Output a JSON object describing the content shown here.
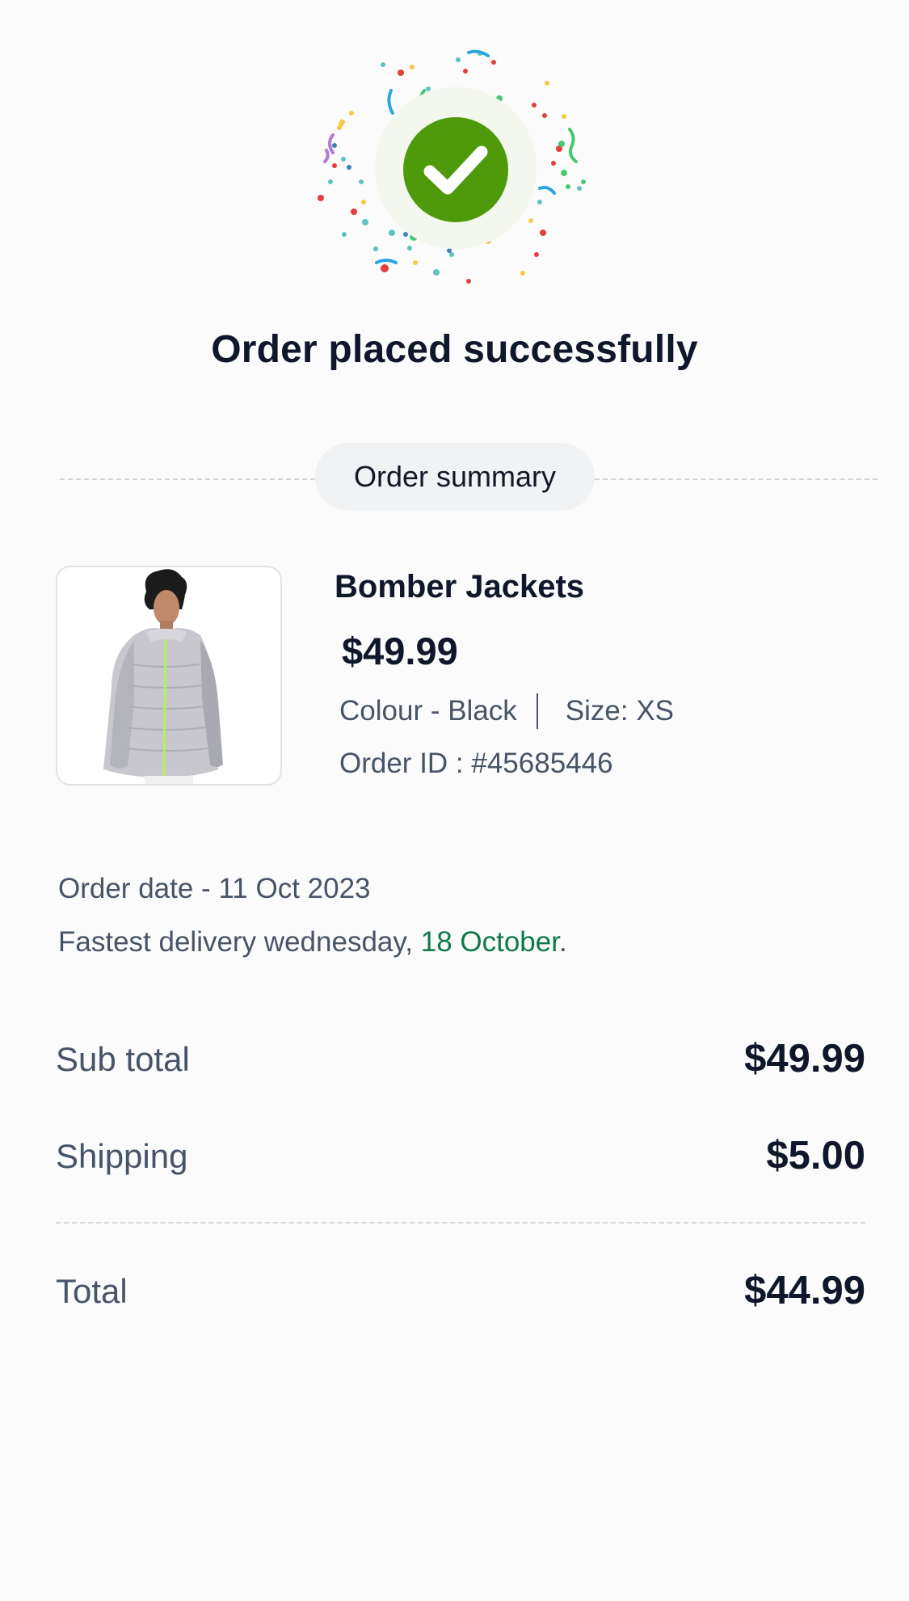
{
  "status": {
    "title": "Order placed successfully",
    "icon": "check-circle-icon",
    "accent_color": "#4e9a0a"
  },
  "summary": {
    "label": "Order summary"
  },
  "product": {
    "name": "Bomber Jackets",
    "price": "$49.99",
    "colour": "Colour - Black",
    "size": "Size: XS",
    "order_id": "Order ID : #45685446",
    "image": "product-jacket-photo"
  },
  "delivery": {
    "order_date": "Order date - 11 Oct 2023",
    "prefix": "Fastest delivery wednesday, ",
    "date": "18 October",
    "suffix": ".",
    "highlight_color": "#0c7a4b"
  },
  "totals": {
    "subtotal_label": "Sub total",
    "subtotal_value": "$49.99",
    "shipping_label": "Shipping",
    "shipping_value": "$5.00",
    "total_label": "Total",
    "total_value": "$44.99"
  }
}
